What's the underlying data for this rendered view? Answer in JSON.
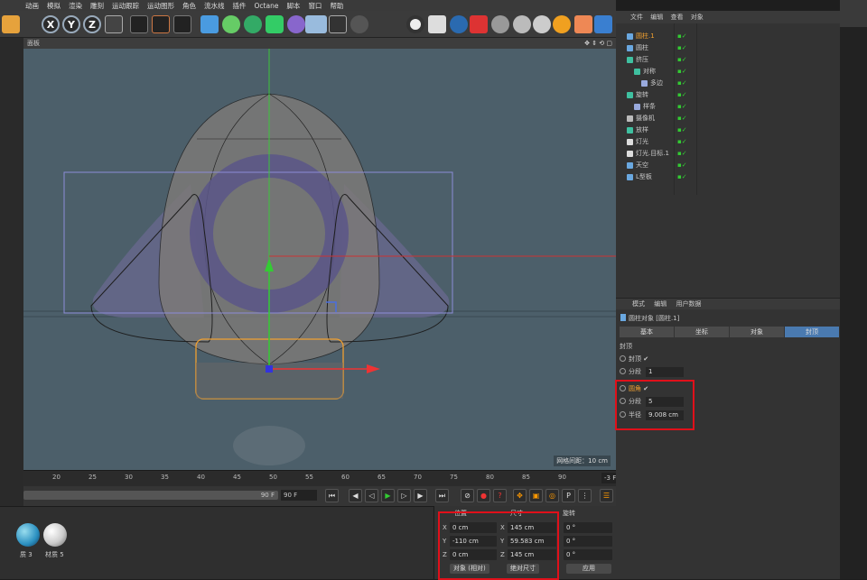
{
  "menu": [
    "动画",
    "模拟",
    "渲染",
    "雕刻",
    "运动跟踪",
    "运动图形",
    "角色",
    "流水线",
    "插件",
    "Octane",
    "脚本",
    "窗口",
    "帮助"
  ],
  "toolbar": {
    "axis_x": "X",
    "axis_y": "Y",
    "axis_z": "Z"
  },
  "viewport": {
    "header": "面板",
    "grid_spacing": "网格间距：10 cm"
  },
  "timeline": {
    "ticks": [
      "20",
      "25",
      "30",
      "35",
      "40",
      "45",
      "50",
      "55",
      "60",
      "65",
      "70",
      "75",
      "80",
      "85",
      "90"
    ],
    "current_frame": "-3 F"
  },
  "transport": {
    "range_end": "90 F",
    "end_field": "90 F"
  },
  "materials": [
    {
      "label": "质 3"
    },
    {
      "label": "材质 5"
    }
  ],
  "coords": {
    "headers": [
      "位置",
      "尺寸",
      "旋转"
    ],
    "rows": [
      {
        "axis": "X",
        "pos": "0 cm",
        "size_axis": "X",
        "size": "145 cm",
        "rot": "0 °"
      },
      {
        "axis": "Y",
        "pos": "-110 cm",
        "size_axis": "Y",
        "size": "59.583 cm",
        "rot": "0 °"
      },
      {
        "axis": "Z",
        "pos": "0 cm",
        "size_axis": "Z",
        "size": "145 cm",
        "rot": "0 °"
      }
    ],
    "mode": "对象 (相对)",
    "size_mode": "绝对尺寸",
    "apply": "应用"
  },
  "objects": {
    "tabs": [
      "文件",
      "编辑",
      "查看",
      "对象"
    ],
    "items": [
      {
        "name": "圆柱.1",
        "indent": 0,
        "color": "#6aa8e0",
        "active": true
      },
      {
        "name": "圆柱",
        "indent": 0,
        "color": "#6aa8e0"
      },
      {
        "name": "挤压",
        "indent": 0,
        "color": "#3fc0a0"
      },
      {
        "name": "对称",
        "indent": 1,
        "color": "#3fc0a0"
      },
      {
        "name": "多边",
        "indent": 2,
        "color": "#9ad"
      },
      {
        "name": "旋转",
        "indent": 0,
        "color": "#3fc0a0"
      },
      {
        "name": "样条",
        "indent": 1,
        "color": "#9ad"
      },
      {
        "name": "摄像机",
        "indent": 0,
        "color": "#bbb"
      },
      {
        "name": "放样",
        "indent": 0,
        "color": "#3fc0a0"
      },
      {
        "name": "灯光",
        "indent": 0,
        "color": "#ddd"
      },
      {
        "name": "灯光.目标.1",
        "indent": 0,
        "color": "#ddd"
      },
      {
        "name": "天空",
        "indent": 0,
        "color": "#6aa8e0"
      },
      {
        "name": "L型板",
        "indent": 0,
        "color": "#6aa8e0"
      }
    ]
  },
  "attributes": {
    "tabs": [
      "模式",
      "编辑",
      "用户数据"
    ],
    "title": "圆柱对象 [圆柱.1]",
    "subtabs": [
      "基本",
      "坐标",
      "对象",
      "封顶"
    ],
    "section": "封顶",
    "rows": [
      {
        "label": "封顶",
        "value": "✔",
        "type": "check"
      },
      {
        "label": "分段",
        "value": "1",
        "type": "field"
      },
      {
        "label": "圆角",
        "value": "✔",
        "type": "check"
      },
      {
        "label": "分段",
        "value": "5",
        "type": "field"
      },
      {
        "label": "半径",
        "value": "9.008 cm",
        "type": "field"
      }
    ]
  },
  "colors": {
    "highlight_box": "#e0101a",
    "viewport_bg": "#4c5f6a",
    "selected_tab": "#4a7ab0"
  }
}
